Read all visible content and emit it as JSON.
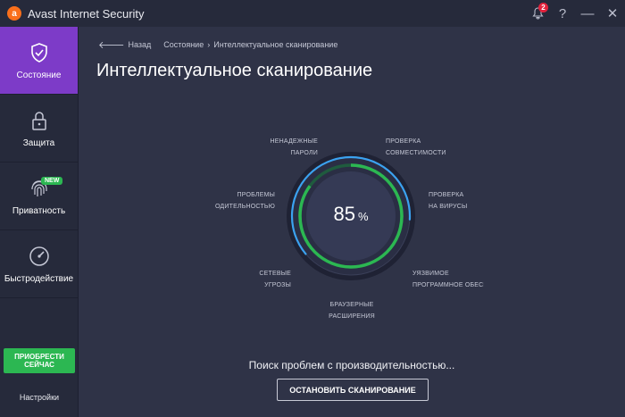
{
  "app": {
    "title": "Avast Internet Security",
    "logo_letter": "a"
  },
  "titlebar": {
    "notification_count": "2",
    "help": "?",
    "minimize": "—",
    "close": "✕"
  },
  "sidebar": {
    "items": [
      {
        "label": "Состояние",
        "icon": "shield-check-icon",
        "active": true
      },
      {
        "label": "Защита",
        "icon": "lock-icon"
      },
      {
        "label": "Приватность",
        "icon": "fingerprint-icon",
        "badge": "NEW"
      },
      {
        "label": "Быстродействие",
        "icon": "speedometer-icon"
      }
    ],
    "buy_button": "ПРИОБРЕСТИ СЕЙЧАС",
    "settings": "Настройки"
  },
  "breadcrumb": {
    "back": "Назад",
    "parent": "Состояние",
    "separator": "›",
    "current": "Интеллектуальное сканирование"
  },
  "page_title": "Интеллектуальное сканирование",
  "scan": {
    "progress_value": "85",
    "progress_unit": "%",
    "progress_fraction": 0.85,
    "labels": {
      "passwords": [
        "НЕНАДЕЖНЫЕ",
        "ПАРОЛИ"
      ],
      "compatibility": [
        "ПРОВЕРКА",
        "СОВМЕСТИМОСТИ"
      ],
      "viruses": [
        "ПРОВЕРКА",
        "НА ВИРУСЫ"
      ],
      "software": [
        "УЯЗВИМОЕ",
        "ПРОГРАММНОЕ ОБЕСП"
      ],
      "browser": [
        "БРАУЗЕРНЫЕ",
        "РАСШИРЕНИЯ"
      ],
      "network": [
        "СЕТЕВЫЕ",
        "УГРОЗЫ"
      ],
      "performance": [
        "ПРОБЛЕМЫ",
        "ОДИТЕЛЬНОСТЬЮ"
      ]
    },
    "status_text": "Поиск проблем с производительностью...",
    "stop_button": "ОСТАНОВИТЬ СКАНИРОВАНИЕ"
  },
  "colors": {
    "accent_purple": "#7d3bc8",
    "accent_green": "#2cb752",
    "ring_blue": "#3ba2f0",
    "bg": "#2f3347"
  }
}
